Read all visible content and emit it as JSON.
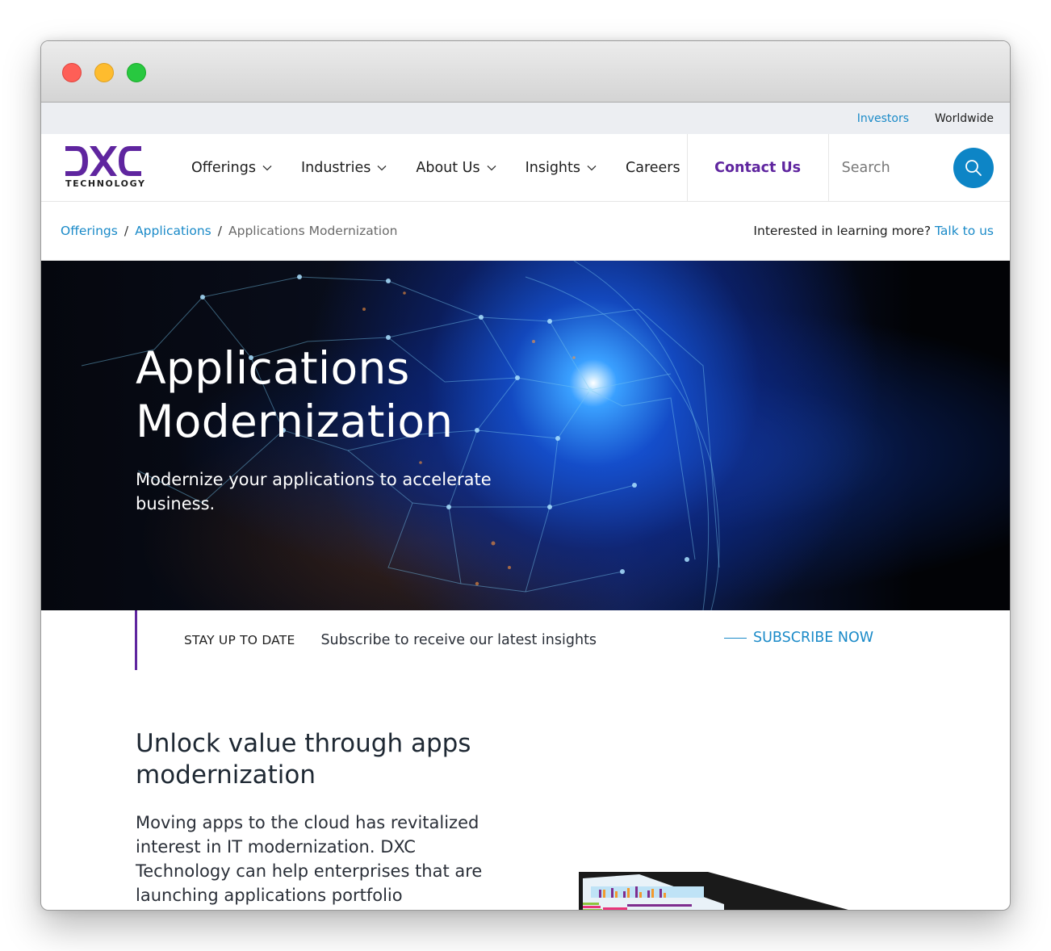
{
  "window": {
    "controls": [
      "close",
      "minimize",
      "maximize"
    ]
  },
  "utility_bar": {
    "investors": "Investors",
    "worldwide": "Worldwide"
  },
  "brand": {
    "logo_text": "DXC",
    "logo_subtext": "TECHNOLOGY",
    "colors": {
      "purple": "#5f259f",
      "blue": "#1a8ac8",
      "search_button": "#0d85c6"
    }
  },
  "nav": {
    "items": [
      {
        "label": "Offerings",
        "has_dropdown": true
      },
      {
        "label": "Industries",
        "has_dropdown": true
      },
      {
        "label": "About Us",
        "has_dropdown": true
      },
      {
        "label": "Insights",
        "has_dropdown": true
      },
      {
        "label": "Careers",
        "has_dropdown": false
      }
    ],
    "contact": "Contact Us",
    "search": {
      "placeholder": "Search",
      "value": "",
      "icon": "search-icon"
    }
  },
  "breadcrumb": {
    "items": [
      "Offerings",
      "Applications"
    ],
    "separator": "/",
    "current": "Applications Modernization"
  },
  "cta_bar": {
    "question": "Interested in learning more?",
    "link": "Talk to us"
  },
  "hero": {
    "title": "Applications Modernization",
    "subtitle": "Modernize your applications to accelerate business."
  },
  "subscribe": {
    "eyebrow": "STAY UP TO DATE",
    "text": "Subscribe to receive our latest insights",
    "button": "SUBSCRIBE NOW"
  },
  "section": {
    "heading": "Unlock value through apps modernization",
    "body": "Moving apps to the cloud has revitalized interest in IT modernization. DXC Technology can help enterprises that are launching applications portfolio"
  }
}
